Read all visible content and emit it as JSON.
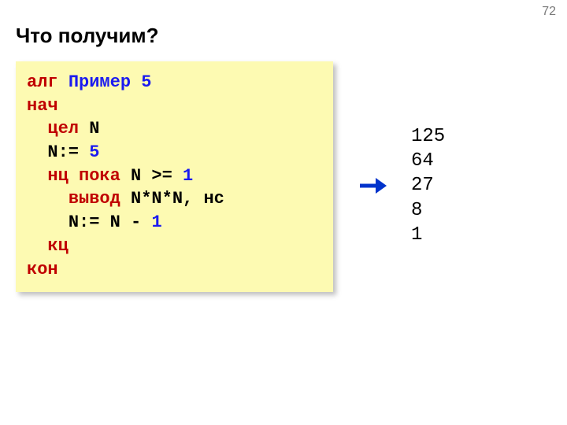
{
  "page_number": "72",
  "title": "Что получим?",
  "code": {
    "l1": {
      "kw": "алг",
      "sp": " ",
      "name": "Пример 5"
    },
    "l2": {
      "kw": "нач"
    },
    "l3": {
      "pad": "  ",
      "kw": "цел",
      "rest": " N"
    },
    "l4": {
      "pad": "  ",
      "a": "N:= ",
      "num": "5"
    },
    "l5": {
      "pad": "  ",
      "kw": "нц пока",
      "mid": " N >= ",
      "num": "1"
    },
    "l6": {
      "pad": "    ",
      "kw": "вывод",
      "rest": " N*N*N, нс"
    },
    "l7": {
      "pad": "    ",
      "a": "N:= N - ",
      "num": "1"
    },
    "l8": {
      "pad": "  ",
      "kw": "кц"
    },
    "l9": {
      "kw": "кон"
    }
  },
  "output_lines": "125\n64\n27\n8\n1"
}
